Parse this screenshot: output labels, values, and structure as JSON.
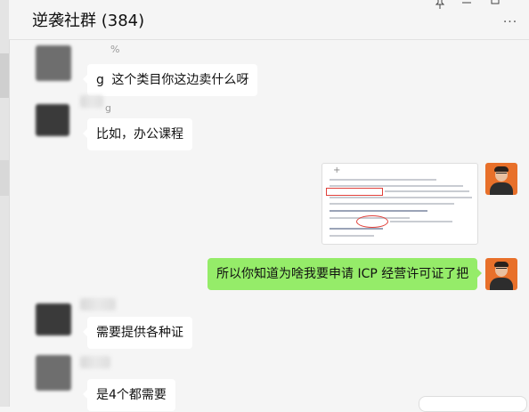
{
  "window": {
    "title": "逆袭社群 (384)",
    "pin_icon": "pin-icon",
    "minimize_icon": "minimize-icon",
    "maximize_icon": "maximize-icon",
    "more_icon": "more-icon"
  },
  "messages": [
    {
      "side": "left",
      "nick_fragment": "%",
      "sender_suffix": "g",
      "text": "这个类目你这边卖什么呀"
    },
    {
      "side": "left",
      "nick_fragment": "g",
      "text": "比如，办公课程"
    },
    {
      "side": "right",
      "type": "image",
      "image_desc": "screenshot-icon"
    },
    {
      "side": "right",
      "text": "所以你知道为啥我要申请 ICP 经营许可证了把"
    },
    {
      "side": "left",
      "text": "需要提供各种证"
    },
    {
      "side": "left",
      "text": "是4个都需要"
    }
  ],
  "colors": {
    "self_bubble": "#95ec69",
    "other_bubble": "#ffffff",
    "background": "#f5f5f5",
    "self_avatar_bg": "#e8702a"
  }
}
